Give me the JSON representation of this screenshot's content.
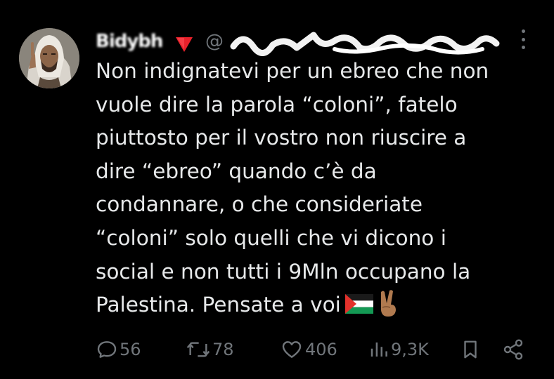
{
  "tweet": {
    "display_name": "Bidybh",
    "handle": "@",
    "text_lines": [
      "Non indignatevi per un ebreo che non",
      "vuole dire la parola “coloni”, fatelo",
      "piuttosto per il vostro non riuscire a",
      "dire “ebreo” quando c’è da",
      "condannare, o che consideriate",
      "“coloni” solo quelli che vi dicono i",
      "social e non tutti i 9Mln occupano la",
      "Palestina. Pensate a voi"
    ]
  },
  "actions": {
    "replies": "56",
    "reposts": "78",
    "likes": "406",
    "views": "9,3K"
  },
  "colors": {
    "background": "#000000",
    "text": "#e7e9ea",
    "muted": "#71767b",
    "name_flag_red": "#e8212b"
  },
  "icons": {
    "name_flag": "red-triangle-icon",
    "reply": "speech-bubble-icon",
    "repost": "repost-arrows-icon",
    "like": "heart-icon",
    "views": "bar-chart-icon",
    "bookmark": "bookmark-icon",
    "share": "share-icon",
    "more": "more-vertical-icon"
  }
}
